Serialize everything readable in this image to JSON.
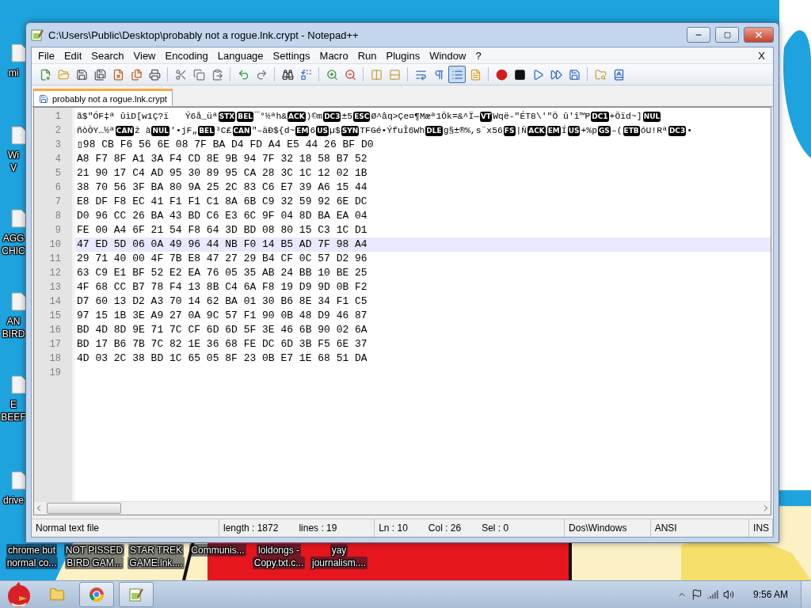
{
  "desktop_icons": [
    {
      "lines": [
        "mi"
      ]
    },
    {
      "lines": [
        "Wi",
        "V"
      ]
    },
    {
      "lines": [
        "AGG",
        "CHIC"
      ]
    },
    {
      "lines": [
        "AN",
        "BIRD"
      ]
    },
    {
      "lines": [
        "E",
        "BEEF"
      ]
    },
    {
      "lines": [
        "drive"
      ]
    }
  ],
  "desktop_labels": [
    {
      "lines": [
        "chrome but",
        "normal co..."
      ]
    },
    {
      "lines": [
        "NOT PISSED",
        "BIRD GAM..."
      ]
    },
    {
      "lines": [
        "STAR TREK",
        "GAME.lnk...."
      ]
    },
    {
      "lines": [
        "Communis..."
      ]
    },
    {
      "lines": [
        "loldongs -",
        "Copy.txt.c..."
      ]
    },
    {
      "lines": [
        "yay",
        "journalism...."
      ]
    }
  ],
  "window": {
    "title": "C:\\Users\\Public\\Desktop\\probably not a rogue.lnk.crypt - Notepad++"
  },
  "menu": {
    "items": [
      "File",
      "Edit",
      "Search",
      "View",
      "Encoding",
      "Language",
      "Settings",
      "Macro",
      "Run",
      "Plugins",
      "Window",
      "?"
    ],
    "close": "X"
  },
  "toolbar": {
    "buttons": [
      {
        "pressed": false
      },
      {
        "pressed": false
      },
      {
        "pressed": false
      },
      {
        "pressed": false
      },
      {
        "pressed": false
      },
      {
        "pressed": false
      },
      {
        "pressed": false
      },
      {
        "pressed": false
      },
      {
        "pressed": false
      },
      {
        "pressed": false
      },
      {
        "pressed": false
      },
      {
        "pressed": false
      },
      {
        "pressed": false
      },
      {
        "pressed": false
      },
      {
        "pressed": false
      },
      {
        "pressed": false
      },
      {
        "pressed": false
      },
      {
        "pressed": false
      },
      {
        "pressed": false
      },
      {
        "pressed": false
      },
      {
        "pressed": true
      },
      {
        "pressed": false
      },
      {
        "pressed": false
      },
      {
        "pressed": false
      },
      {
        "pressed": false
      },
      {
        "pressed": false
      },
      {
        "pressed": false
      },
      {
        "pressed": false
      },
      {
        "pressed": false
      }
    ]
  },
  "tabs": [
    {
      "label": "probably not a rogue.lnk.crypt",
      "selected": true
    }
  ],
  "editor": {
    "lines": [
      {
        "number": "1",
        "current": false,
        "segments": [
          {
            "kind": "text",
            "text": "ã$\"ÓF‡ª ûìD[w1Ç?ï   Ý6å_üª"
          },
          {
            "kind": "control",
            "text": "STX"
          },
          {
            "kind": "control",
            "text": "BEL"
          },
          {
            "kind": "text",
            "text": "¯°½ªh&"
          },
          {
            "kind": "control",
            "text": "ACK"
          },
          {
            "kind": "text",
            "text": ")©m"
          },
          {
            "kind": "control",
            "text": "DC3"
          },
          {
            "kind": "text",
            "text": "±5"
          },
          {
            "kind": "control",
            "text": "ESC"
          },
          {
            "kind": "text",
            "text": "Ø^âq>Çe¤¶Mæª1Õk=&^Ï—"
          },
          {
            "kind": "control",
            "text": "VT"
          },
          {
            "kind": "text",
            "text": "Wqë-\"ÉT8\\'\"Ö û'î™P"
          },
          {
            "kind": "control",
            "text": "DC1"
          },
          {
            "kind": "text",
            "text": "+Öïd~]"
          },
          {
            "kind": "control",
            "text": "NUL"
          }
        ]
      },
      {
        "number": "2",
        "current": false,
        "segments": [
          {
            "kind": "text",
            "text": "ñòÒY…½ª"
          },
          {
            "kind": "control",
            "text": "CAN"
          },
          {
            "kind": "text",
            "text": "ž à"
          },
          {
            "kind": "control",
            "text": "NUL"
          },
          {
            "kind": "text",
            "text": "'•jF„"
          },
          {
            "kind": "control",
            "text": "BEL"
          },
          {
            "kind": "text",
            "text": "³C£"
          },
          {
            "kind": "control",
            "text": "CAN"
          },
          {
            "kind": "text",
            "text": "\"–äÐ${d~"
          },
          {
            "kind": "control",
            "text": "EM"
          },
          {
            "kind": "text",
            "text": "6"
          },
          {
            "kind": "control",
            "text": "US"
          },
          {
            "kind": "text",
            "text": "µ$"
          },
          {
            "kind": "control",
            "text": "SYN"
          },
          {
            "kind": "text",
            "text": "TFGé•ÝfuÎ6Wh"
          },
          {
            "kind": "control",
            "text": "DLE"
          },
          {
            "kind": "text",
            "text": "g§±®%,s¨x56"
          },
          {
            "kind": "control",
            "text": "FS"
          },
          {
            "kind": "text",
            "text": "|Ñ"
          },
          {
            "kind": "control",
            "text": "ACK"
          },
          {
            "kind": "control",
            "text": "EM"
          },
          {
            "kind": "text",
            "text": "Í"
          },
          {
            "kind": "control",
            "text": "US"
          },
          {
            "kind": "text",
            "text": "+%p"
          },
          {
            "kind": "control",
            "text": "GS"
          },
          {
            "kind": "text",
            "text": "–("
          },
          {
            "kind": "control",
            "text": "ETB"
          },
          {
            "kind": "text",
            "text": "óU!Rª"
          },
          {
            "kind": "control",
            "text": "DC3"
          },
          {
            "kind": "text",
            "text": "•"
          }
        ]
      },
      {
        "number": "3",
        "current": false,
        "segments": [
          {
            "kind": "text",
            "text": "▯98 CB F6 56 6E 08 7F BA D4 FD A4 E5 44 26 BF D0"
          }
        ]
      },
      {
        "number": "4",
        "current": false,
        "segments": [
          {
            "kind": "text",
            "text": "A8 F7 8F A1 3A F4 CD 8E 9B 94 7F 32 18 58 B7 52"
          }
        ]
      },
      {
        "number": "5",
        "current": false,
        "segments": [
          {
            "kind": "text",
            "text": "21 90 17 C4 AD 95 30 89 95 CA 28 3C 1C 12 02 1B"
          }
        ]
      },
      {
        "number": "6",
        "current": false,
        "segments": [
          {
            "kind": "text",
            "text": "38 70 56 3F BA 80 9A 25 2C 83 C6 E7 39 A6 15 44"
          }
        ]
      },
      {
        "number": "7",
        "current": false,
        "segments": [
          {
            "kind": "text",
            "text": "E8 DF F8 EC 41 F1 F1 C1 8A 6B C9 32 59 92 6E DC"
          }
        ]
      },
      {
        "number": "8",
        "current": false,
        "segments": [
          {
            "kind": "text",
            "text": "D0 96 CC 26 BA 43 BD C6 E3 6C 9F 04 8D BA EA 04"
          }
        ]
      },
      {
        "number": "9",
        "current": false,
        "segments": [
          {
            "kind": "text",
            "text": "FE 00 A4 6F 21 54 F8 64 3D BD 08 80 15 C3 1C D1"
          }
        ]
      },
      {
        "number": "10",
        "current": true,
        "segments": [
          {
            "kind": "text",
            "text": "47 ED 5D 06 0A 49 96 44 NB F0 14 B5 AD 7F 98 A4"
          }
        ]
      },
      {
        "number": "11",
        "current": false,
        "segments": [
          {
            "kind": "text",
            "text": "29 71 40 00 4F 7B E8 47 27 29 B4 CF 0C 57 D2 96"
          }
        ]
      },
      {
        "number": "12",
        "current": false,
        "segments": [
          {
            "kind": "text",
            "text": "63 C9 E1 BF 52 E2 EA 76 05 35 AB 24 BB 10 BE 25"
          }
        ]
      },
      {
        "number": "13",
        "current": false,
        "segments": [
          {
            "kind": "text",
            "text": "4F 68 CC B7 78 F4 13 8B C4 6A F8 19 D9 9D 0B F2"
          }
        ]
      },
      {
        "number": "14",
        "current": false,
        "segments": [
          {
            "kind": "text",
            "text": "D7 60 13 D2 A3 70 14 62 BA 01 30 B6 8E 34 F1 C5"
          }
        ]
      },
      {
        "number": "15",
        "current": false,
        "segments": [
          {
            "kind": "text",
            "text": "97 15 1B 3E A9 27 0A 9C 57 F1 90 0B 48 D9 46 87"
          }
        ]
      },
      {
        "number": "16",
        "current": false,
        "segments": [
          {
            "kind": "text",
            "text": "BD 4D 8D 9E 71 7C CF 6D 6D 5F 3E 46 6B 90 02 6A"
          }
        ]
      },
      {
        "number": "17",
        "current": false,
        "segments": [
          {
            "kind": "text",
            "text": "BD 17 B6 7B 7C 82 1E 36 68 FE DC 6D 3B F5 6E 37"
          }
        ]
      },
      {
        "number": "18",
        "current": false,
        "segments": [
          {
            "kind": "text",
            "text": "4D 03 2C 38 BD 1C 65 05 8F 23 0B E7 1E 68 51 DA"
          }
        ]
      },
      {
        "number": "19",
        "current": false
      }
    ]
  },
  "status_bar": {
    "cells": [
      {
        "texts": [
          "Normal text file"
        ]
      },
      {
        "texts": [
          "length : 1872",
          "lines : 19"
        ]
      },
      {
        "texts": [
          "Ln : 10",
          "Col : 26",
          "Sel : 0"
        ]
      },
      {
        "texts": [
          "Dos\\Windows"
        ]
      },
      {
        "texts": [
          "ANSI"
        ]
      },
      {
        "texts": [
          "INS"
        ]
      }
    ]
  },
  "taskbar": {
    "clock": "9:56 AM"
  }
}
